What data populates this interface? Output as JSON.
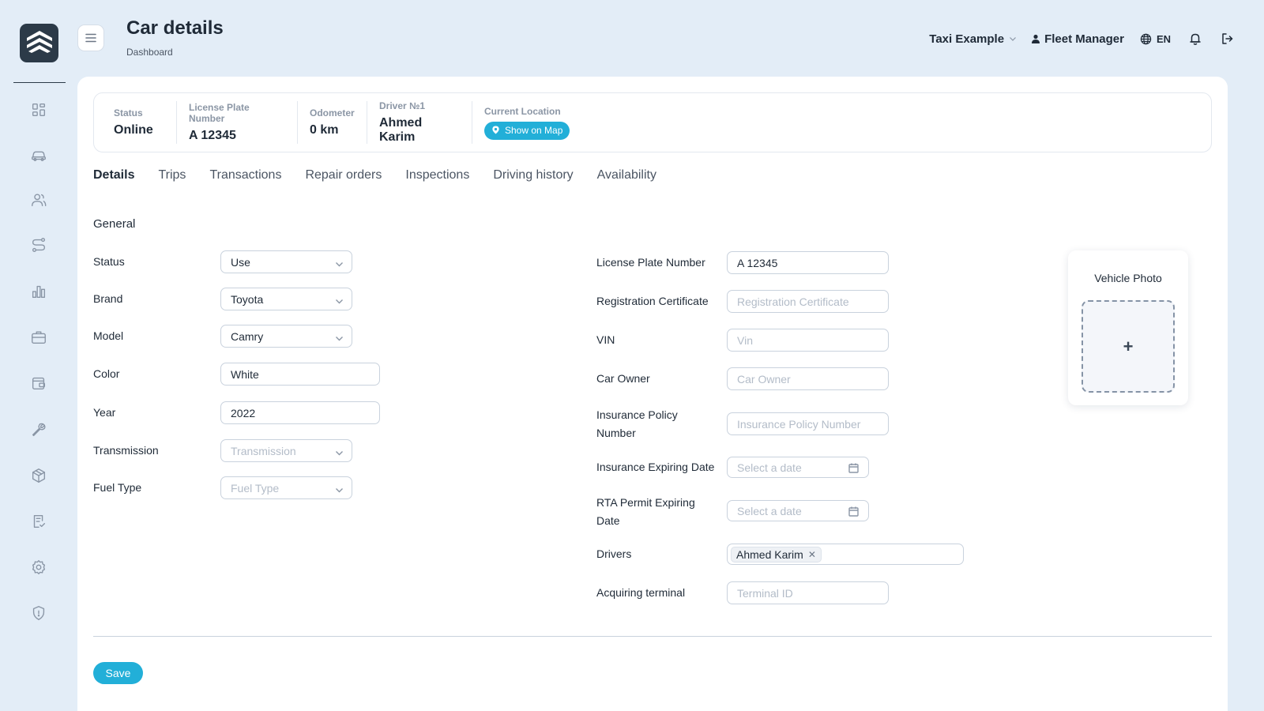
{
  "header": {
    "title": "Car details",
    "breadcrumb": "Dashboard",
    "company": "Taxi Example",
    "user": "Fleet Manager",
    "language": "EN"
  },
  "summary": {
    "status_label": "Status",
    "status_value": "Online",
    "plate_label": "License Plate Number",
    "plate_value": "A 12345",
    "odometer_label": "Odometer",
    "odometer_value": "0 km",
    "driver_label": "Driver №1",
    "driver_value": "Ahmed Karim",
    "location_label": "Current Location",
    "location_button": "Show on Map"
  },
  "tabs": [
    "Details",
    "Trips",
    "Transactions",
    "Repair orders",
    "Inspections",
    "Driving history",
    "Availability"
  ],
  "section_title": "General",
  "left_form": {
    "status": {
      "label": "Status",
      "value": "Use"
    },
    "brand": {
      "label": "Brand",
      "value": "Toyota"
    },
    "model": {
      "label": "Model",
      "value": "Camry"
    },
    "color": {
      "label": "Color",
      "value": "White"
    },
    "year": {
      "label": "Year",
      "value": "2022"
    },
    "transmission": {
      "label": "Transmission",
      "placeholder": "Transmission"
    },
    "fuel": {
      "label": "Fuel Type",
      "placeholder": "Fuel Type"
    }
  },
  "right_form": {
    "plate": {
      "label": "License Plate Number",
      "value": "A 12345"
    },
    "registration": {
      "label": "Registration Certificate",
      "placeholder": "Registration Certificate"
    },
    "vin": {
      "label": "VIN",
      "placeholder": "Vin"
    },
    "owner": {
      "label": "Car Owner",
      "placeholder": "Car Owner"
    },
    "insurance": {
      "label": "Insurance Policy Number",
      "placeholder": "Insurance Policy Number"
    },
    "insurance_date": {
      "label": "Insurance Expiring Date",
      "placeholder": "Select a date"
    },
    "rta_date": {
      "label": "RTA Permit Expiring Date",
      "placeholder": "Select a date"
    },
    "drivers": {
      "label": "Drivers",
      "tag": "Ahmed Karim"
    },
    "terminal": {
      "label": "Acquiring terminal",
      "placeholder": "Terminal ID"
    }
  },
  "photo": {
    "title": "Vehicle Photo",
    "add": "+"
  },
  "save_label": "Save",
  "colors": {
    "accent": "#22afd8",
    "background": "#e3edf7",
    "logo": "#2c3a48"
  }
}
